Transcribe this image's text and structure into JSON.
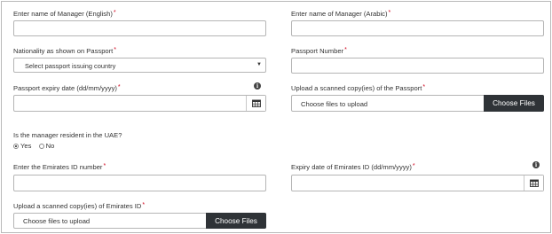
{
  "fields": {
    "manager_name_en": {
      "label": "Enter name of Manager (English)",
      "required_mark": "*",
      "value": ""
    },
    "manager_name_ar": {
      "label": "Enter name of Manager (Arabic)",
      "required_mark": "*",
      "value": ""
    },
    "nationality": {
      "label": "Nationality as shown on Passport",
      "required_mark": "*",
      "selected": "Select passport issuing country"
    },
    "passport_number": {
      "label": "Passport Number",
      "required_mark": "*",
      "value": ""
    },
    "passport_expiry": {
      "label": "Passport expiry date (dd/mm/yyyy)",
      "required_mark": "*",
      "value": ""
    },
    "passport_upload": {
      "label": "Upload a scanned copy(ies) of the Passport",
      "required_mark": "*",
      "placeholder": "Choose files to upload",
      "button": "Choose Files"
    },
    "resident": {
      "question": "Is the manager resident in the UAE?",
      "options": [
        {
          "label": "Yes",
          "selected": true
        },
        {
          "label": "No",
          "selected": false
        }
      ]
    },
    "emirates_id": {
      "label": "Enter the Emirates ID number",
      "required_mark": "*",
      "value": ""
    },
    "emirates_id_expiry": {
      "label": "Expiry date of Emirates ID (dd/mm/yyyy)",
      "required_mark": "*",
      "value": ""
    },
    "emirates_id_upload": {
      "label": "Upload a scanned copy(ies) of Emirates ID",
      "required_mark": "*",
      "placeholder": "Choose files to upload",
      "button": "Choose Files"
    }
  },
  "icons": {
    "info": "info-icon",
    "calendar": "calendar-icon",
    "caret": "caret-down-icon"
  },
  "colors": {
    "required": "#d0021b",
    "button_bg": "#2f3337",
    "border": "#b5b5b5"
  }
}
